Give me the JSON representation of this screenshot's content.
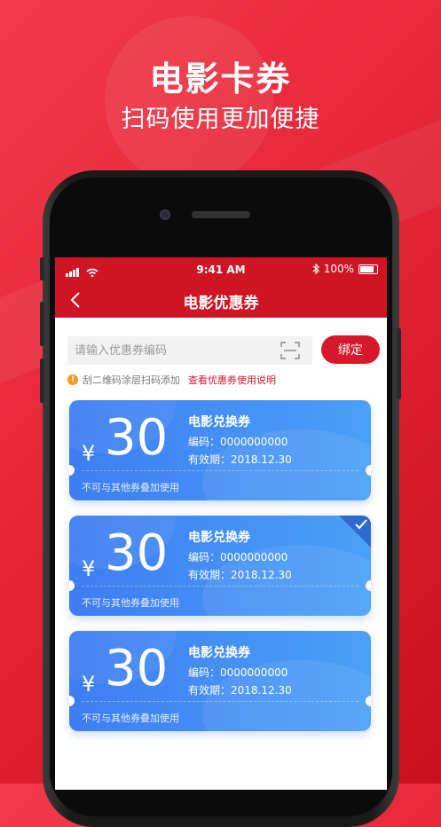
{
  "promo": {
    "title": "电影卡券",
    "subtitle": "扫码使用更加便捷"
  },
  "status_bar": {
    "time": "9:41 AM",
    "battery": "100%"
  },
  "nav": {
    "title": "电影优惠券"
  },
  "search": {
    "placeholder": "请输入优惠券编码",
    "value": "",
    "bind_label": "绑定"
  },
  "tip": {
    "text": "刮二维码涂层扫码添加",
    "link": "查看优惠券使用说明"
  },
  "coupons": [
    {
      "currency": "¥",
      "amount": "30",
      "title": "电影兑换券",
      "code": "编码：0000000000",
      "expiry": "有效期：2018.12.30",
      "note": "不可与其他券叠加使用",
      "selected": false
    },
    {
      "currency": "¥",
      "amount": "30",
      "title": "电影兑换券",
      "code": "编码：0000000000",
      "expiry": "有效期：2018.12.30",
      "note": "不可与其他券叠加使用",
      "selected": true
    },
    {
      "currency": "¥",
      "amount": "30",
      "title": "电影兑换券",
      "code": "编码：0000000000",
      "expiry": "有效期：2018.12.30",
      "note": "不可与其他券叠加使用",
      "selected": false
    }
  ],
  "colors": {
    "brand_red": "#d6182a",
    "coupon_blue_start": "#3e7df2",
    "coupon_blue_end": "#4aa0f7"
  }
}
